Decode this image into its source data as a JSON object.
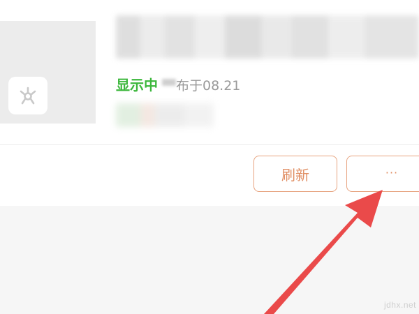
{
  "card": {
    "status_shown": "显示中",
    "published_date": "布于08.21"
  },
  "actions": {
    "refresh_label": "刷新",
    "more_label": "···"
  },
  "watermark": {
    "text": "jdhx.net"
  },
  "colors": {
    "status_green": "#3cb73c",
    "button_orange": "#e08e63",
    "arrow_red": "#ea4a4a"
  },
  "icons": {
    "thumbnail": "app-logo-icon"
  }
}
